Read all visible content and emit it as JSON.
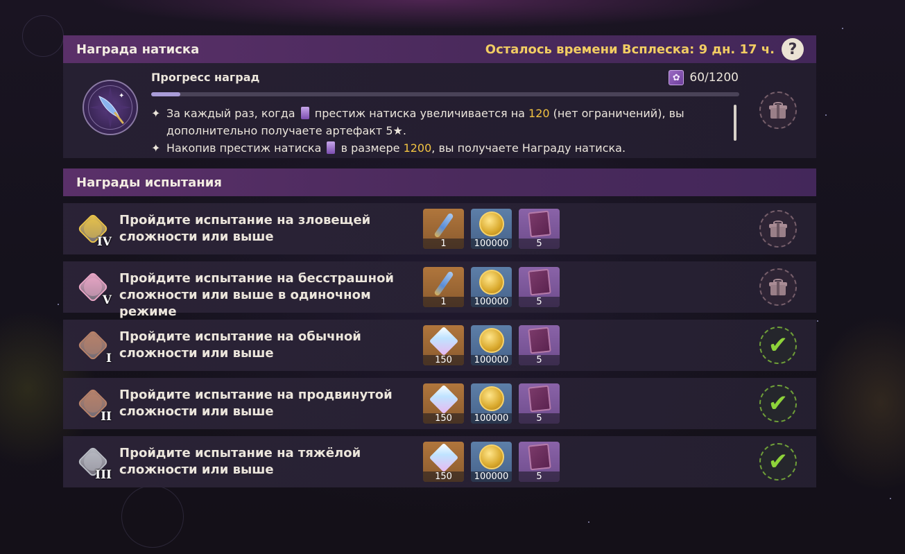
{
  "abyss_reward": {
    "title": "Награда натиска",
    "time_left": "Осталось времени Всплеска: 9 дн. 17 ч.",
    "help": "?",
    "progress_title": "Прогресс наград",
    "progress_count": "60/1200",
    "progress_fraction": 0.05,
    "rules": [
      {
        "parts": [
          "За каждый раз, когда ",
          " престиж натиска увеличивается на ",
          "120",
          " (нет ограничений), вы дополнительно получаете артефакт 5★."
        ]
      },
      {
        "parts": [
          "Накопив престиж натиска ",
          " в размере ",
          "1200",
          ", вы получаете Награду натиска."
        ]
      }
    ]
  },
  "challenge_section": {
    "title": "Награды испытания"
  },
  "challenges": [
    {
      "numeral": "IV",
      "emblem_color": "#e8c24a",
      "text_line1": "Пройдите испытание на зловещей",
      "text_line2": "сложности или выше",
      "items": [
        {
          "icon": "quill-artifact-icon",
          "qty": "1"
        },
        {
          "icon": "mora-coin-icon",
          "qty": "100000"
        },
        {
          "icon": "exp-book-icon",
          "qty": "5"
        }
      ],
      "status": "gift-icon"
    },
    {
      "numeral": "V",
      "emblem_color": "#e9a6c6",
      "text_line1": "Пройдите испытание на бесстрашной",
      "text_line2": "сложности или выше в одиночном режиме",
      "items": [
        {
          "icon": "quill-artifact-icon",
          "qty": "1"
        },
        {
          "icon": "mora-coin-icon",
          "qty": "100000"
        },
        {
          "icon": "exp-book-icon",
          "qty": "5"
        }
      ],
      "status": "gift-icon"
    },
    {
      "numeral": "I",
      "emblem_color": "#b8826a",
      "text_line1": "Пройдите испытание на обычной",
      "text_line2": "сложности или выше",
      "items": [
        {
          "icon": "primogem-icon",
          "qty": "150"
        },
        {
          "icon": "mora-coin-icon",
          "qty": "100000"
        },
        {
          "icon": "exp-book-icon",
          "qty": "5"
        }
      ],
      "status": "check-icon"
    },
    {
      "numeral": "II",
      "emblem_color": "#b8826a",
      "text_line1": "Пройдите испытание на продвинутой",
      "text_line2": "сложности или выше",
      "items": [
        {
          "icon": "primogem-icon",
          "qty": "150"
        },
        {
          "icon": "mora-coin-icon",
          "qty": "100000"
        },
        {
          "icon": "exp-book-icon",
          "qty": "5"
        }
      ],
      "status": "check-icon"
    },
    {
      "numeral": "III",
      "emblem_color": "#b9bcc4",
      "text_line1": "Пройдите испытание на тяжёлой",
      "text_line2": "сложности или выше",
      "items": [
        {
          "icon": "primogem-icon",
          "qty": "150"
        },
        {
          "icon": "mora-coin-icon",
          "qty": "100000"
        },
        {
          "icon": "exp-book-icon",
          "qty": "5"
        }
      ],
      "status": "check-icon"
    }
  ]
}
